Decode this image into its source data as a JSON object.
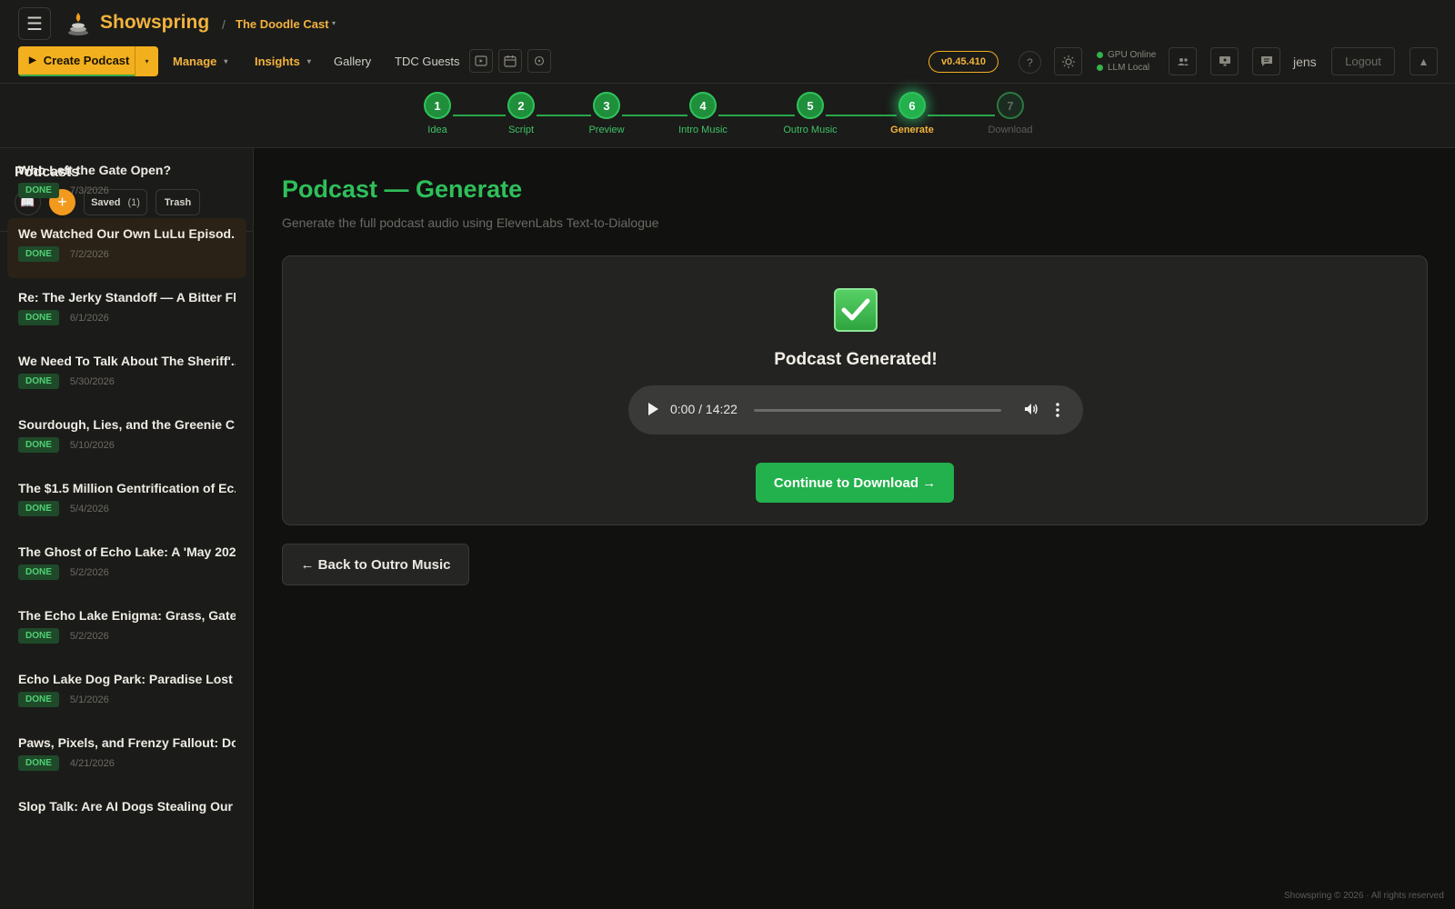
{
  "header": {
    "brand": "Showspring",
    "breadcrumb_sep": "/",
    "show_name": "The Doodle Cast",
    "create_label": "Create Podcast",
    "nav": {
      "manage": "Manage",
      "insights": "Insights",
      "gallery": "Gallery",
      "guests": "TDC Guests"
    },
    "version": "v0.45.410",
    "help": "?",
    "status": {
      "gpu": "GPU Online",
      "llm": "LLM Local"
    },
    "user": "jens",
    "logout": "Logout",
    "icons": [
      "menu-icon",
      "logo-icon",
      "video-icon",
      "calendar-icon",
      "clock-icon",
      "help-icon",
      "sun-icon",
      "users-icon",
      "monitor-icon",
      "chat-icon",
      "arrow-up-icon"
    ]
  },
  "stepper": {
    "steps": [
      {
        "num": "1",
        "label": "Idea",
        "state": "done"
      },
      {
        "num": "2",
        "label": "Script",
        "state": "done"
      },
      {
        "num": "3",
        "label": "Preview",
        "state": "done"
      },
      {
        "num": "4",
        "label": "Intro Music",
        "state": "done"
      },
      {
        "num": "5",
        "label": "Outro Music",
        "state": "done"
      },
      {
        "num": "6",
        "label": "Generate",
        "state": "active"
      },
      {
        "num": "7",
        "label": "Download",
        "state": "todo"
      }
    ]
  },
  "sidebar": {
    "title": "Podcasts",
    "saved_label": "Saved",
    "saved_count": "(1)",
    "trash_label": "Trash",
    "episodes": [
      {
        "title": "Who Left the Gate Open?",
        "status": "DONE",
        "date": "7/3/2026"
      },
      {
        "title": "We Watched Our Own LuLu Episod...",
        "status": "DONE",
        "date": "7/2/2026"
      },
      {
        "title": "Re: The Jerky Standoff — A Bitter Fl...",
        "status": "DONE",
        "date": "6/1/2026"
      },
      {
        "title": "We Need To Talk About The Sheriff'...",
        "status": "DONE",
        "date": "5/30/2026"
      },
      {
        "title": "Sourdough, Lies, and the Greenie C...",
        "status": "DONE",
        "date": "5/10/2026"
      },
      {
        "title": "The $1.5 Million Gentrification of Ec...",
        "status": "DONE",
        "date": "5/4/2026"
      },
      {
        "title": "The Ghost of Echo Lake: A 'May 202...",
        "status": "DONE",
        "date": "5/2/2026"
      },
      {
        "title": "The Echo Lake Enigma: Grass, Gates...",
        "status": "DONE",
        "date": "5/2/2026"
      },
      {
        "title": "Echo Lake Dog Park: Paradise Lost ...",
        "status": "DONE",
        "date": "5/1/2026"
      },
      {
        "title": "Paws, Pixels, and Frenzy Fallout: Do...",
        "status": "DONE",
        "date": "4/21/2026"
      },
      {
        "title": "Slop Talk: Are AI Dogs Stealing Our ...",
        "status": "",
        "date": ""
      }
    ]
  },
  "main": {
    "title": "Podcast — Generate",
    "subtitle": "Generate the full podcast audio using ElevenLabs Text-to-Dialogue",
    "card_title": "Podcast Generated!",
    "player": {
      "time": "0:00 / 14:22",
      "progress": 0
    },
    "continue_label": "Continue to Download →",
    "back_label": "← Back to Outro Music"
  },
  "footer": "Showspring © 2026 · All rights reserved",
  "colors": {
    "accent_gold": "#f2b33d",
    "accent_green": "#2fbf5a",
    "background": "#111110",
    "panel": "#1b1b19"
  }
}
